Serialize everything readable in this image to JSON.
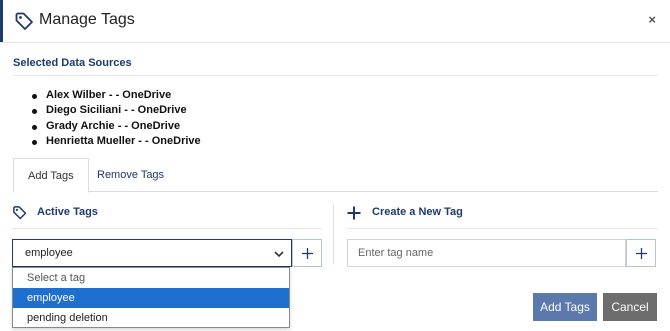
{
  "dialog": {
    "title": "Manage Tags",
    "close_glyph": "×",
    "accent_color": "#1e3a6e"
  },
  "selected_sources": {
    "title": "Selected Data Sources",
    "items": [
      "Alex Wilber - - OneDrive",
      "Diego Siciliani - - OneDrive",
      "Grady Archie - - OneDrive",
      "Henrietta Mueller - - OneDrive"
    ]
  },
  "tabs": [
    {
      "label": "Add Tags",
      "active": true
    },
    {
      "label": "Remove Tags",
      "active": false
    }
  ],
  "active_tags": {
    "heading": "Active Tags",
    "selected_value": "employee",
    "options": [
      "Select a tag",
      "employee",
      "pending deletion"
    ],
    "highlighted_option": "employee"
  },
  "create_tag": {
    "heading": "Create a New Tag",
    "placeholder": "Enter tag name"
  },
  "footer": {
    "add_label": "Add Tags",
    "cancel_label": "Cancel",
    "add_color": "#5c79ad",
    "cancel_color": "#6d6d6d"
  },
  "icons": {
    "title_icon": "tag-icon",
    "active_tags_icon": "tag-icon",
    "create_icon": "plus-icon"
  }
}
